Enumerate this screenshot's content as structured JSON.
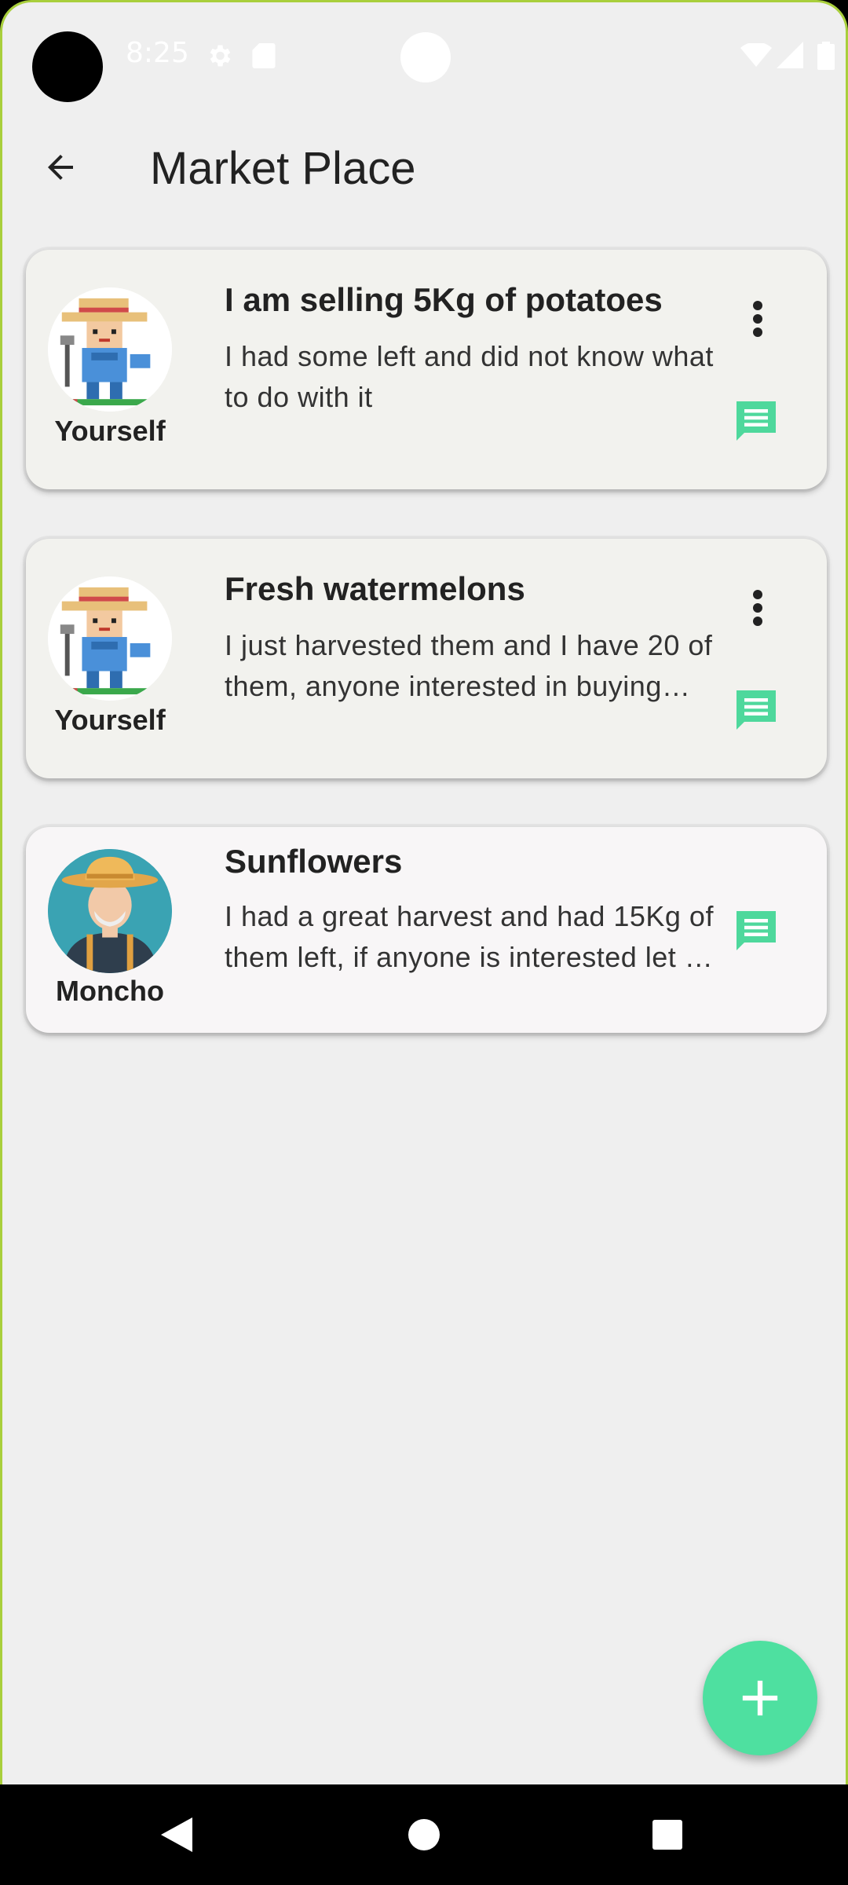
{
  "status_bar": {
    "time": "8:25"
  },
  "app_bar": {
    "title": "Market Place"
  },
  "posts": [
    {
      "author": "Yourself",
      "title": "I am selling 5Kg of potatoes",
      "body": "I had some left and did not know what to do with it",
      "own": true
    },
    {
      "author": "Yourself",
      "title": "Fresh watermelons",
      "body": "I just harvested them and I have 20 of them, anyone interested in buying them?",
      "own": true
    },
    {
      "author": "Moncho",
      "title": "Sunflowers",
      "body": "I had a great harvest and had 15Kg of them left, if anyone is interested let me know",
      "own": false
    }
  ],
  "icons": {
    "back": "arrow-back-icon",
    "more": "more-vert-icon",
    "chat": "chat-icon",
    "add": "add-icon"
  },
  "colors": {
    "accent": "#4ee0a0",
    "chat_icon": "#4ed89c",
    "frame": "#a9cf3c",
    "background": "#efefef"
  }
}
